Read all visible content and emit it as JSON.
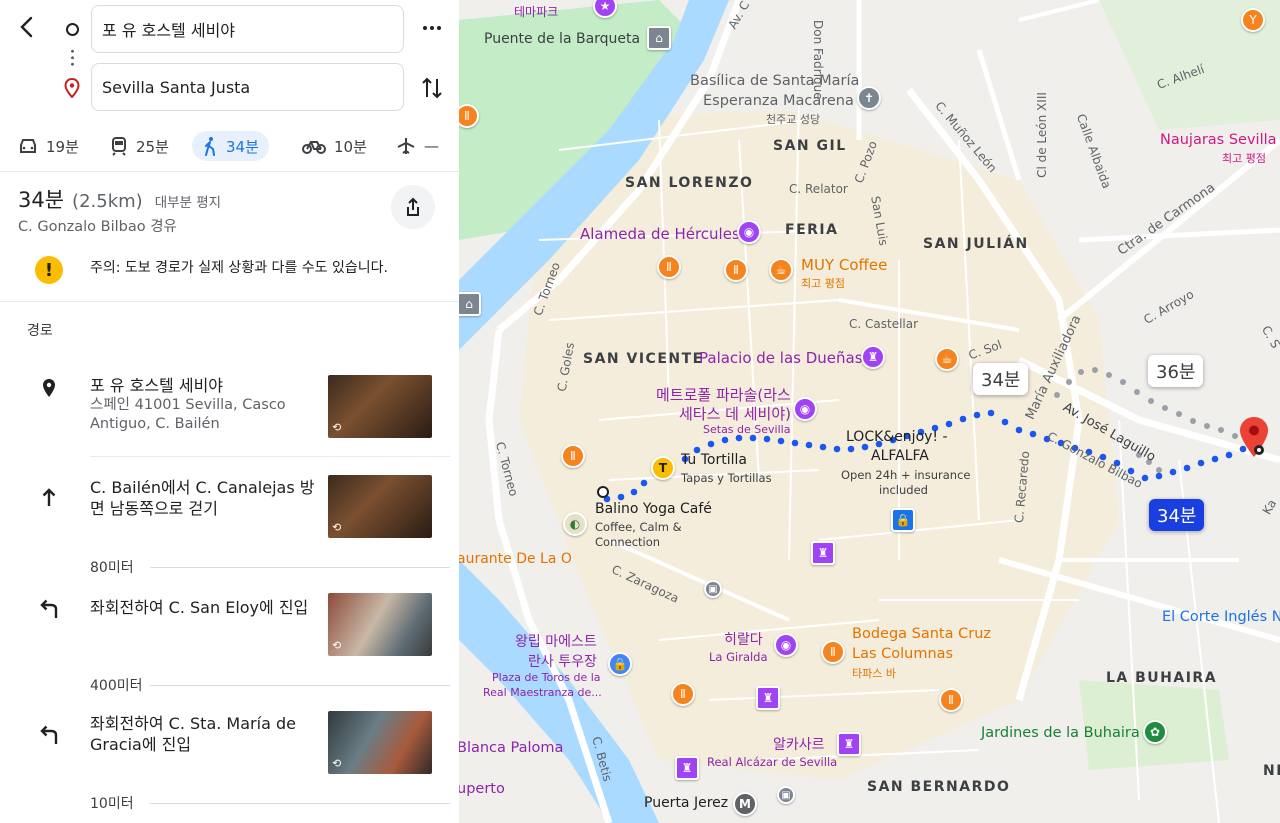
{
  "header": {
    "origin_value": "포 유 호스텔 세비야",
    "destination_value": "Sevilla Santa Justa"
  },
  "modes": [
    {
      "icon": "car-icon",
      "label": "19분"
    },
    {
      "icon": "train-icon",
      "label": "25분"
    },
    {
      "icon": "walk-icon",
      "label": "34분",
      "active": true
    },
    {
      "icon": "bike-icon",
      "label": "10분"
    },
    {
      "icon": "plane-icon",
      "label": "—"
    }
  ],
  "summary": {
    "time": "34분",
    "distance": "(2.5km)",
    "terrain": "대부분 평지",
    "via": "C. Gonzalo Bilbao 경유",
    "warning": "주의: 도보 경로가 실제 상황과 다를 수도 있습니다."
  },
  "route_heading": "경로",
  "steps": [
    {
      "icon": "place-marker-icon",
      "title": "포 유 호스텔 세비야",
      "subtitle": "스페인 41001 Sevilla, Casco Antiguo, C. Bailén"
    },
    {
      "icon": "arrow-up-icon",
      "title": "C. Bailén에서 C. Canalejas 방면 남동쪽으로 걷기",
      "distance": "80미터"
    },
    {
      "icon": "turn-left-icon",
      "title": "좌회전하여 C. San Eloy에 진입",
      "distance": "400미터"
    },
    {
      "icon": "turn-left-icon",
      "title": "좌회전하여 C. Sta. María de Gracia에 진입",
      "distance": "10미터"
    }
  ],
  "map": {
    "areas": {
      "san_gil": "SAN GIL",
      "san_lorenzo": "SAN LORENZO",
      "feria": "FERIA",
      "san_julian": "SAN JULIÁN",
      "san_vicente": "SAN VICENTE",
      "la_buhaira": "LA BUHAIRA",
      "san_bernardo": "SAN BERNARDO",
      "ne": "NE"
    },
    "streets": {
      "puente_barqueta": "Puente de la Barqueta",
      "av_c": "Av. C",
      "don_fadrique": "Don Fadrique",
      "c_alhelí": "C. Alhelí",
      "calle_albaida": "Calle Albaida",
      "c_munoz_leon": "C. Muñoz León",
      "cl_leon_xiii": "Cl de León XIII",
      "c_pozo": "C. Pozo",
      "c_relator": "C. Relator",
      "san_luis": "San Luis",
      "ctra_carmona": "Ctra. de Carmona",
      "c_arroyo": "C. Arroyo",
      "c_torneo_top": "C. Torneo",
      "c_castellar": "C. Castellar",
      "c_sol": "C. Sol",
      "av_auxiliadora": "María Auxiliadora",
      "av_jose_laguillo": "Av. José Laguillo",
      "c_gonzalo_bilbao": "C. Gonzalo Bilbao",
      "c_goles": "C. Goles",
      "c_torneo": "C. Torneo",
      "c_recaredo": "C. Recaredo",
      "c_zaragoza": "C. Zaragoza",
      "c_betis": "C. Betis",
      "k_ka": "Ka",
      "c_s": "C. S"
    },
    "pois": {
      "theme_park": "테마파크",
      "basilica_1": "Basílica de Santa María",
      "basilica_2": "Esperanza Macarena",
      "basilica_ko": "천주교 성당",
      "naujaras": "Naujaras Sevilla",
      "naujaras_sub": "최고 평점",
      "alameda": "Alameda de Hércules",
      "muy_coffee": "MUY Coffee",
      "muy_sub": "최고 평점",
      "palacio": "Palacio de las Dueñas",
      "metropol_1": "메트로폴 파라솔(라스",
      "metropol_2": "세타스 데 세비야)",
      "metropol_en": "Setas de Sevilla",
      "lock_1": "LOCK&enjoy! -",
      "lock_2": "ALFALFA",
      "lock_sub_1": "Open 24h + insurance",
      "lock_sub_2": "included",
      "tu_tortilla": "Tu Tortilla",
      "tu_tortilla_sub": "Tapas y Tortillas",
      "balino": "Balino Yoga Café",
      "balino_sub_1": "Coffee, Calm &",
      "balino_sub_2": "Connection",
      "restaurante": "aurante De La O",
      "maestranza_1": "왕립 마에스트",
      "maestranza_2": "란사 투우장",
      "maestranza_en_1": "Plaza de Toros de la",
      "maestranza_en_2": "Real Maestranza de...",
      "giralda": "히랄다",
      "giralda_en": "La Giralda",
      "bodega_1": "Bodega Santa Cruz",
      "bodega_2": "Las Columnas",
      "bodega_sub": "타파스 바",
      "corte_ingles": "El Corte Inglés Nerv",
      "buhaira_gardens": "Jardines de la Buhaira",
      "alcazar": "알카사르",
      "alcazar_en": "Real Alcázar de Sevilla",
      "blanca_paloma": "Blanca Paloma",
      "puerto": "uperto",
      "puerta_jerez": "Puerta Jerez",
      "metro_m": "M"
    },
    "route_labels": {
      "alt_1": "34분",
      "alt_2": "36분",
      "active": "34분"
    },
    "colors": {
      "route": "#1a56f0",
      "alt_route": "#9aa0a6",
      "water": "#aadaff",
      "park": "#c3ecc7",
      "destination": "#ea4335"
    }
  }
}
